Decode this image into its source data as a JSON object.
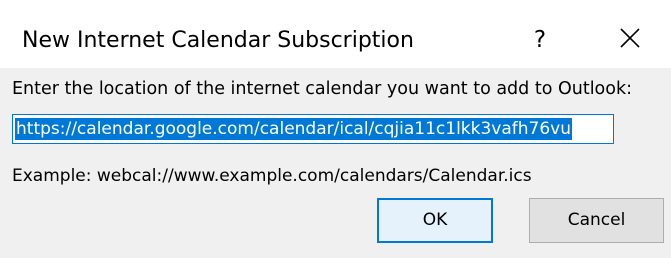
{
  "window": {
    "title": "New Internet Calendar Subscription",
    "help_label": "?",
    "close_icon": "close-icon"
  },
  "form": {
    "prompt": "Enter the location of the internet calendar you want to add to Outlook:",
    "url_value": "https://calendar.google.com/calendar/ical/cqjia11c1lkk3vafh76vu",
    "example": "Example: webcal://www.example.com/calendars/Calendar.ics"
  },
  "buttons": {
    "ok_label": "OK",
    "cancel_label": "Cancel"
  },
  "colors": {
    "accent": "#0078d7",
    "body_background": "#f0f0f0",
    "button_background": "#e1e1e1"
  }
}
